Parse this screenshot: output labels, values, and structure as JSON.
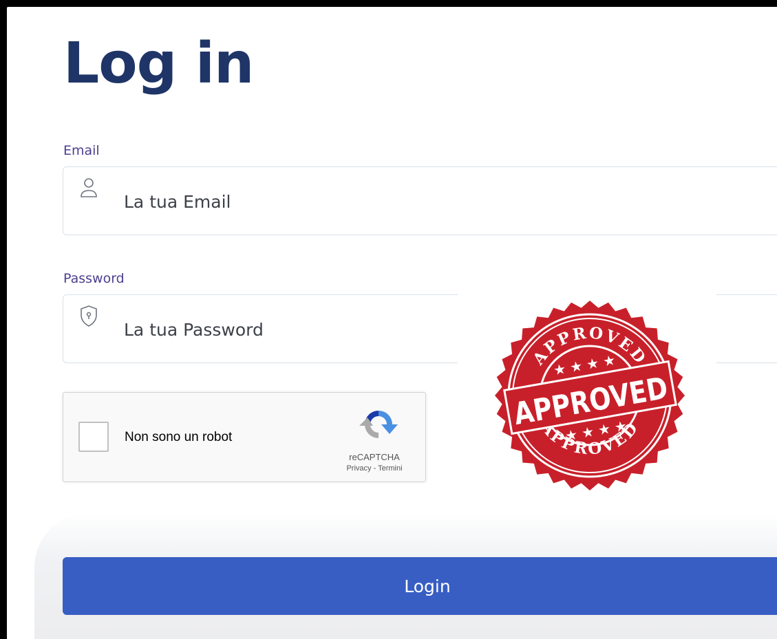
{
  "page": {
    "title": "Log in"
  },
  "email": {
    "label": "Email",
    "placeholder": "La tua Email",
    "icon": "user-icon"
  },
  "password": {
    "label": "Password",
    "placeholder": "La tua Password",
    "icon": "shield-lock-icon"
  },
  "captcha": {
    "checkbox_text": "Non sono un robot",
    "brand": "reCAPTCHA",
    "privacy": "Privacy",
    "separator": " - ",
    "terms": "Termini",
    "checked": false
  },
  "login_button": {
    "label": "Login"
  },
  "stamp": {
    "text_top": "APPROVED",
    "text_center": "APPROVED",
    "text_bottom": "APPROVED",
    "color": "#c8202a"
  },
  "colors": {
    "title": "#1f3567",
    "label": "#4b3f8f",
    "button": "#385ec3"
  }
}
